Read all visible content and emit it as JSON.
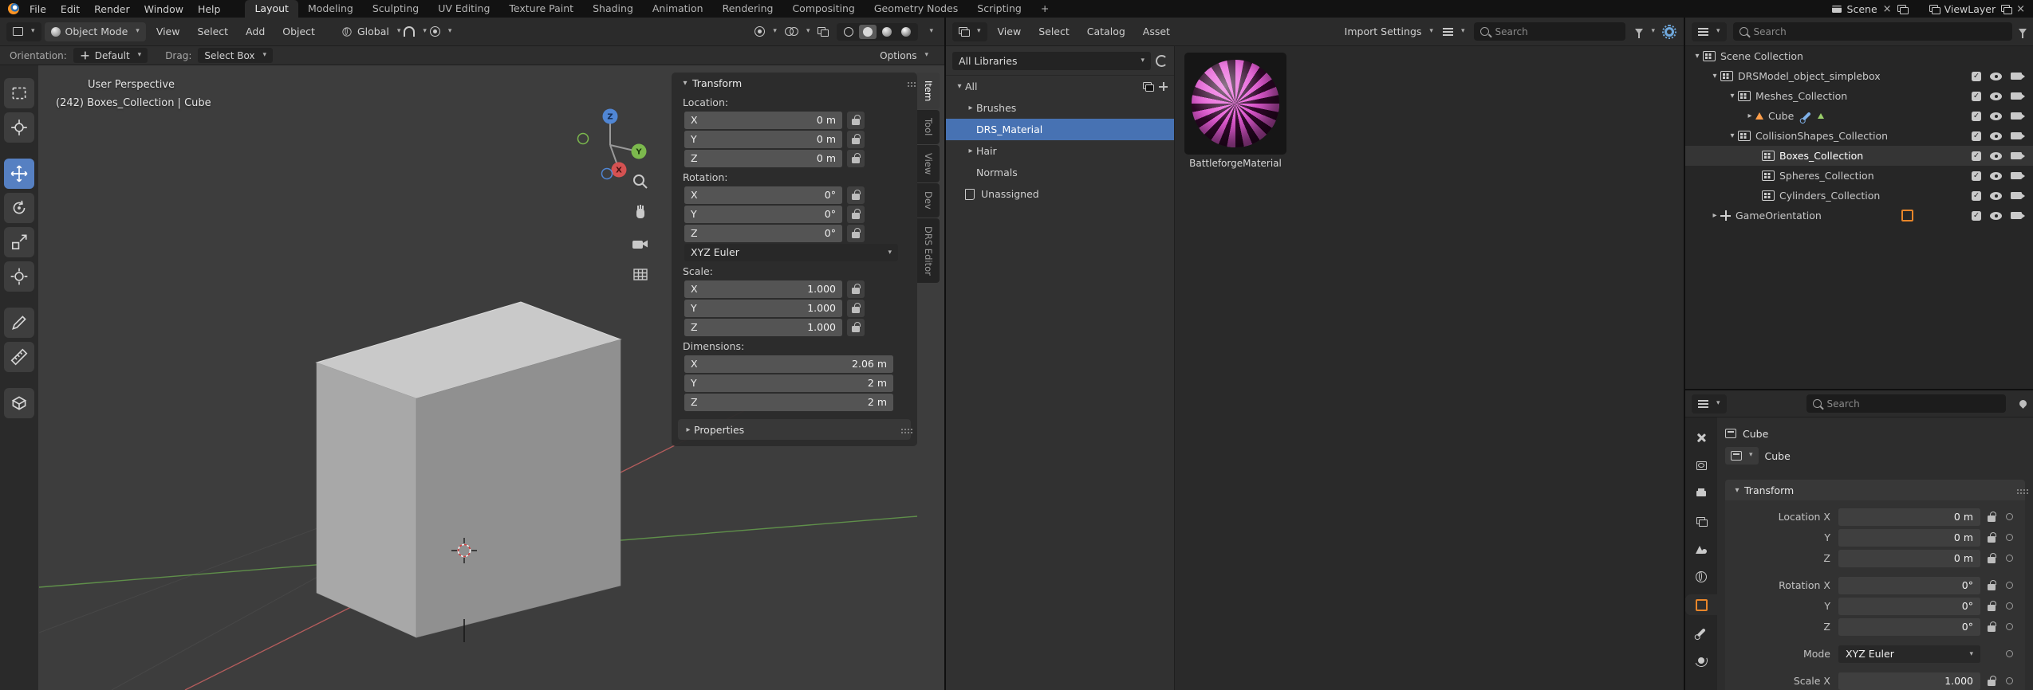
{
  "colors": {
    "accent_blue": "#4772b3",
    "blender_orange": "#e8862a",
    "asset_pink": "#e95bd9",
    "viewport_bg": "#3d3d3d"
  },
  "topbar": {
    "menus": [
      "File",
      "Edit",
      "Render",
      "Window",
      "Help"
    ],
    "workspaces": [
      "Layout",
      "Modeling",
      "Sculpting",
      "UV Editing",
      "Texture Paint",
      "Shading",
      "Animation",
      "Rendering",
      "Compositing",
      "Geometry Nodes",
      "Scripting"
    ],
    "workspace_add": "+",
    "scene_label": "Scene",
    "viewlayer_label": "ViewLayer"
  },
  "viewport": {
    "header": {
      "mode": "Object Mode",
      "menus": [
        "View",
        "Select",
        "Add",
        "Object"
      ],
      "orientation": "Global"
    },
    "tool_settings": {
      "orientation_label": "Orientation:",
      "orientation_value": "Default",
      "drag_label": "Drag:",
      "drag_value": "Select Box",
      "options_label": "Options"
    },
    "overlay": {
      "line1": "User Perspective",
      "line2": "(242) Boxes_Collection | Cube"
    },
    "gizmo": {
      "x": "X",
      "y": "Y",
      "z": "Z"
    }
  },
  "npanel": {
    "tabs": [
      "Item",
      "Tool",
      "View",
      "Dev",
      "DRS Editor"
    ],
    "transform_title": "Transform",
    "axes": {
      "x": "X",
      "y": "Y",
      "z": "Z"
    },
    "location_label": "Location:",
    "loc_x": "0 m",
    "loc_y": "0 m",
    "loc_z": "0 m",
    "rotation_label": "Rotation:",
    "rot_x": "0°",
    "rot_y": "0°",
    "rot_z": "0°",
    "rot_mode": "XYZ Euler",
    "scale_label": "Scale:",
    "scl_x": "1.000",
    "scl_y": "1.000",
    "scl_z": "1.000",
    "dim_label": "Dimensions:",
    "dim_x": "2.06 m",
    "dim_y": "2 m",
    "dim_z": "2 m",
    "properties_label": "Properties"
  },
  "assets": {
    "menus": [
      "View",
      "Select",
      "Catalog",
      "Asset"
    ],
    "import_settings": "Import Settings",
    "search_placeholder": "Search",
    "library": "All Libraries",
    "catalogs": [
      {
        "label": "All"
      },
      {
        "label": "Brushes"
      },
      {
        "label": "DRS_Material"
      },
      {
        "label": "Hair"
      },
      {
        "label": "Normals"
      },
      {
        "label": "Unassigned"
      }
    ],
    "asset_name": "BattleforgeMaterial"
  },
  "outliner": {
    "search_placeholder": "Search",
    "rows": [
      {
        "label": "Scene Collection"
      },
      {
        "label": "DRSModel_object_simplebox"
      },
      {
        "label": "Meshes_Collection"
      },
      {
        "label": "Cube"
      },
      {
        "label": "CollisionShapes_Collection"
      },
      {
        "label": "Boxes_Collection"
      },
      {
        "label": "Spheres_Collection"
      },
      {
        "label": "Cylinders_Collection"
      },
      {
        "label": "GameOrientation"
      }
    ]
  },
  "props": {
    "search_placeholder": "Search",
    "object_name": "Cube",
    "data_name": "Cube",
    "transform_title": "Transform",
    "rows": [
      {
        "label": "Location X",
        "value": "0 m"
      },
      {
        "label": "Y",
        "value": "0 m"
      },
      {
        "label": "Z",
        "value": "0 m"
      },
      {
        "label": "Rotation X",
        "value": "0°"
      },
      {
        "label": "Y",
        "value": "0°"
      },
      {
        "label": "Z",
        "value": "0°"
      },
      {
        "label": "Mode",
        "value": "XYZ Euler"
      },
      {
        "label": "Scale X",
        "value": "1.000"
      }
    ]
  }
}
